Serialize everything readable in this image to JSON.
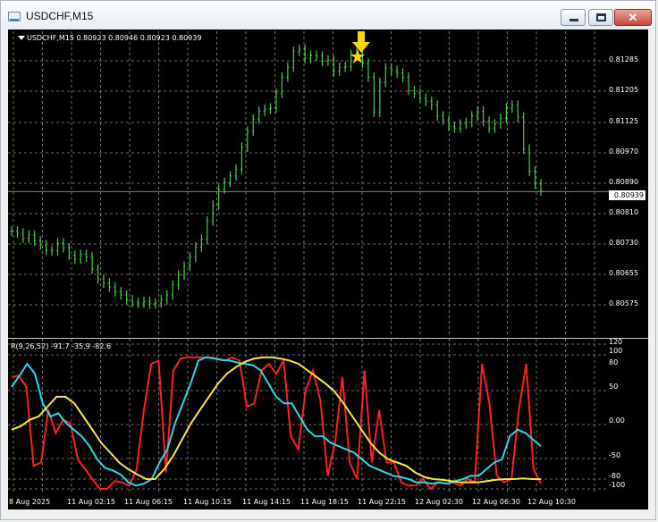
{
  "window": {
    "title": "USDCHF,M15",
    "controls": {
      "minimize": "minimize-button",
      "maximize": "maximize-button",
      "close": "✕"
    }
  },
  "main_chart": {
    "info": "USDCHF,M15  0.80923 0.80946 0.80923 0.80939",
    "current_price": "0.80939",
    "price_ticks": [
      "0.81285",
      "0.81205",
      "0.81125",
      "0.80970",
      "0.80890",
      "0.80810",
      "0.80730",
      "0.80655",
      "0.80575"
    ],
    "marker_arrow_color": "#ffd400",
    "marker_star_color": "#ffd400"
  },
  "oscillator": {
    "info": "R(9,26,52) -91.7 -35.9 -82.6",
    "ticks": [
      "120",
      "100",
      "80",
      "50",
      "0.00",
      "-50",
      "-80",
      "-100"
    ]
  },
  "time_axis": [
    "8 Aug 2025",
    "11 Aug 02:15",
    "11 Aug 06:15",
    "11 Aug 10:15",
    "11 Aug 14:15",
    "11 Aug 18:15",
    "11 Aug 22:15",
    "12 Aug 02:30",
    "12 Aug 06:30",
    "12 Aug 10:30"
  ],
  "chart_data": [
    {
      "type": "line",
      "title": "USDCHF,M15",
      "series": [
        {
          "name": "USDCHF",
          "color": "#4ec94e",
          "values": [
            0.8084,
            0.80835,
            0.80822,
            0.8083,
            0.80815,
            0.80805,
            0.80792,
            0.8079,
            0.8081,
            0.80798,
            0.8078,
            0.8077,
            0.80782,
            0.80775,
            0.80745,
            0.8072,
            0.8071,
            0.807,
            0.80688,
            0.8068,
            0.80668,
            0.80662,
            0.8066,
            0.80664,
            0.80658,
            0.8066,
            0.80668,
            0.8068,
            0.80705,
            0.8073,
            0.80752,
            0.80775,
            0.808,
            0.8082,
            0.80865,
            0.80905,
            0.80945,
            0.80962,
            0.80978,
            0.80995,
            0.8105,
            0.8109,
            0.8112,
            0.8114,
            0.81145,
            0.81148,
            0.81185,
            0.81225,
            0.8125,
            0.8129,
            0.81295,
            0.81272,
            0.8128,
            0.81278,
            0.81265,
            0.81268,
            0.8124,
            0.8125,
            0.81252,
            0.81282,
            0.81288,
            0.8126,
            0.81225,
            0.81138,
            0.81212,
            0.81248,
            0.81242,
            0.81235,
            0.81225,
            0.81192,
            0.81185,
            0.81172,
            0.81165,
            0.81155,
            0.81128,
            0.81118,
            0.81102,
            0.81098,
            0.81108,
            0.81112,
            0.81128,
            0.8114,
            0.81115,
            0.81098,
            0.81108,
            0.81122,
            0.81148,
            0.81155,
            0.81125,
            0.81045,
            0.8099,
            0.80958,
            0.8094
          ]
        }
      ],
      "ylim": [
        0.80575,
        0.8134
      ]
    },
    {
      "type": "line",
      "title": "R(9,26,52) -91.7 -35.9 -82.6",
      "series": [
        {
          "name": "R(9)",
          "color": "#ff2020",
          "values": [
            70,
            72,
            55,
            -65,
            -60,
            20,
            -15,
            5,
            0,
            -55,
            -70,
            -85,
            -100,
            -100,
            -88,
            -90,
            -95,
            -70,
            20,
            90,
            95,
            -75,
            80,
            98,
            100,
            100,
            100,
            100,
            98,
            95,
            100,
            95,
            25,
            30,
            80,
            90,
            75,
            95,
            -20,
            -40,
            50,
            80,
            35,
            -80,
            -30,
            70,
            -60,
            -85,
            80,
            -60,
            20,
            -60,
            -60,
            -90,
            -95,
            -95,
            -85,
            -100,
            -90,
            -92,
            -90,
            -95,
            -85,
            -90,
            90,
            30,
            -80,
            -90,
            -85,
            20,
            90,
            -70,
            -92
          ]
        },
        {
          "name": "R(26)",
          "color": "#26d9e5",
          "values": [
            55,
            72,
            90,
            75,
            30,
            10,
            15,
            0,
            -10,
            -20,
            -35,
            -55,
            -68,
            -72,
            -78,
            -90,
            -95,
            -92,
            -85,
            -60,
            -40,
            0,
            30,
            60,
            95,
            100,
            98,
            96,
            95,
            92,
            90,
            88,
            80,
            60,
            40,
            30,
            30,
            10,
            -10,
            -20,
            -20,
            -30,
            -35,
            -40,
            -45,
            -55,
            -65,
            -70,
            -75,
            -80,
            -82,
            -85,
            -90,
            -90,
            -92,
            -90,
            -92,
            -88,
            -85,
            -80,
            -80,
            -70,
            -60,
            -55,
            -20,
            -10,
            -15,
            -25,
            -35
          ]
        },
        {
          "name": "R(52)",
          "color": "#f5e642",
          "values": [
            -10,
            -5,
            5,
            10,
            25,
            40,
            40,
            30,
            10,
            -10,
            -30,
            -45,
            -60,
            -70,
            -78,
            -85,
            -85,
            -70,
            -50,
            -25,
            0,
            20,
            40,
            60,
            75,
            85,
            93,
            98,
            100,
            100,
            98,
            95,
            90,
            80,
            70,
            60,
            48,
            30,
            10,
            -10,
            -30,
            -45,
            -55,
            -60,
            -65,
            -75,
            -82,
            -85,
            -86,
            -88,
            -90,
            -90,
            -90,
            -88,
            -86,
            -85,
            -85,
            -84,
            -85,
            -85
          ]
        }
      ],
      "ylim": [
        -100,
        120
      ]
    }
  ]
}
